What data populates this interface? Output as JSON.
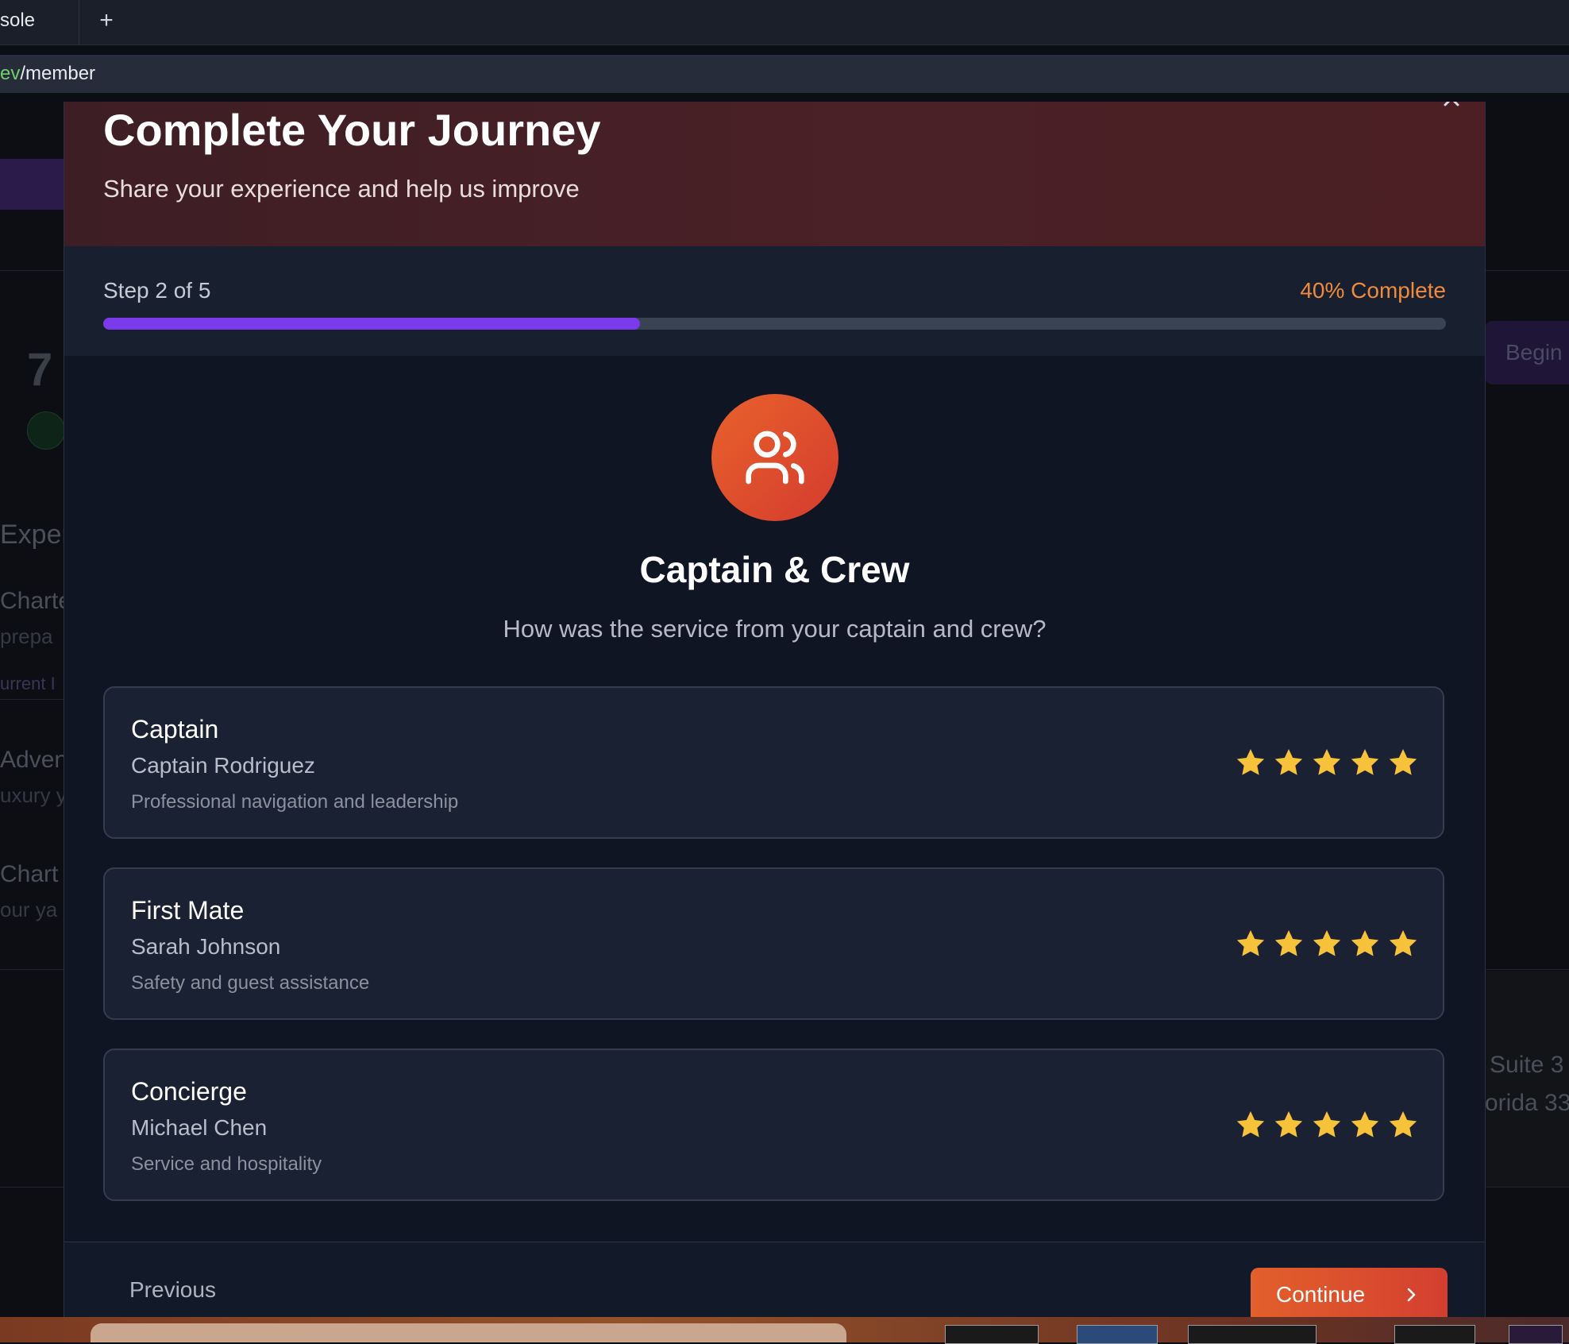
{
  "browser": {
    "tab_title": "sole",
    "new_tab_label": "+",
    "url_scheme_tail": "ev",
    "url_path": "/member"
  },
  "background": {
    "big_number": "7",
    "texts": [
      "Exper",
      "Charte",
      "prepa",
      "urrent I",
      "Adven",
      "uxury y",
      "Chart",
      "our ya",
      "Suite 3",
      "orida 33"
    ],
    "begin_label": "Begin"
  },
  "modal": {
    "title": "Complete Your Journey",
    "subtitle": "Share your experience and help us improve",
    "close_icon": "close-icon",
    "progress": {
      "step_label": "Step 2 of 5",
      "percent_label": "40% Complete",
      "fraction": 0.4
    },
    "step": {
      "icon": "users-icon",
      "title": "Captain & Crew",
      "question": "How was the service from your captain and crew?"
    },
    "crew": [
      {
        "role": "Captain",
        "name": "Captain Rodriguez",
        "description": "Professional navigation and leadership",
        "rating": 5
      },
      {
        "role": "First Mate",
        "name": "Sarah Johnson",
        "description": "Safety and guest assistance",
        "rating": 5
      },
      {
        "role": "Concierge",
        "name": "Michael Chen",
        "description": "Service and hospitality",
        "rating": 5
      }
    ],
    "footer": {
      "previous_label": "Previous",
      "continue_label": "Continue"
    }
  },
  "colors": {
    "accent_purple": "#7c3aed",
    "accent_orange": "#f08a3c",
    "star": "#f7c13a",
    "continue_gradient_start": "#e2602b",
    "continue_gradient_end": "#d43f30"
  }
}
